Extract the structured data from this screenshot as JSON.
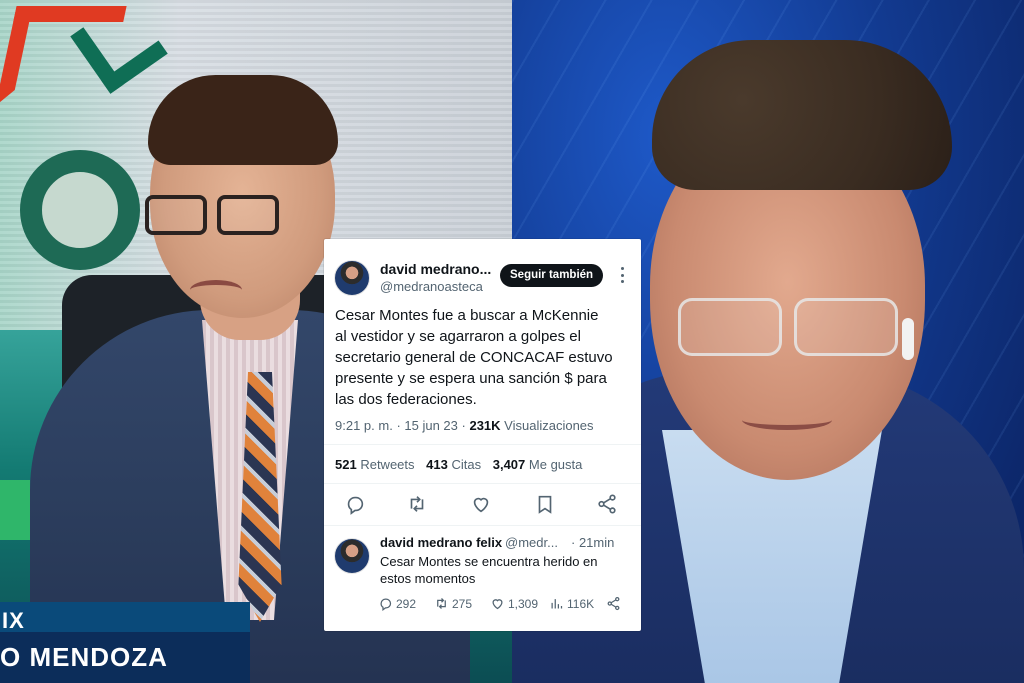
{
  "left_panel": {
    "lower_third_prefix": "IX",
    "lower_third_name": "O MENDOZA"
  },
  "tweet": {
    "display_name": "david medrano...",
    "handle": "@medranoasteca",
    "follow_label": "Seguir también",
    "text_lines": [
      "Cesar Montes fue a buscar a McKennie",
      "al vestidor y se agarraron a golpes el",
      "secretario general de CONCACAF estuvo",
      "presente y se espera una sanción $ para",
      "las dos federaciones."
    ],
    "time": "9:21 p. m.",
    "date": "15 jun 23",
    "views_count": "231K",
    "views_label": "Visualizaciones",
    "retweets_count": "521",
    "retweets_label": "Retweets",
    "quotes_count": "413",
    "quotes_label": "Citas",
    "likes_count": "3,407",
    "likes_label": "Me gusta",
    "actions": [
      "reply-icon",
      "retweet-icon",
      "like-icon",
      "bookmark-icon",
      "share-icon"
    ]
  },
  "reply": {
    "display_name": "david medrano felix",
    "handle": "@medr...",
    "time": "· 21min",
    "text_lines": [
      "Cesar Montes se encuentra herido en",
      "estos momentos"
    ],
    "replies": "292",
    "retweets": "275",
    "likes": "1,309",
    "views": "116K"
  },
  "colors": {
    "tweet_text": "#0f1419",
    "tweet_secondary": "#536471",
    "follow_button_bg": "#0f1419",
    "left_studio_teal": "#137a72",
    "right_background_blue": "#123a90"
  }
}
